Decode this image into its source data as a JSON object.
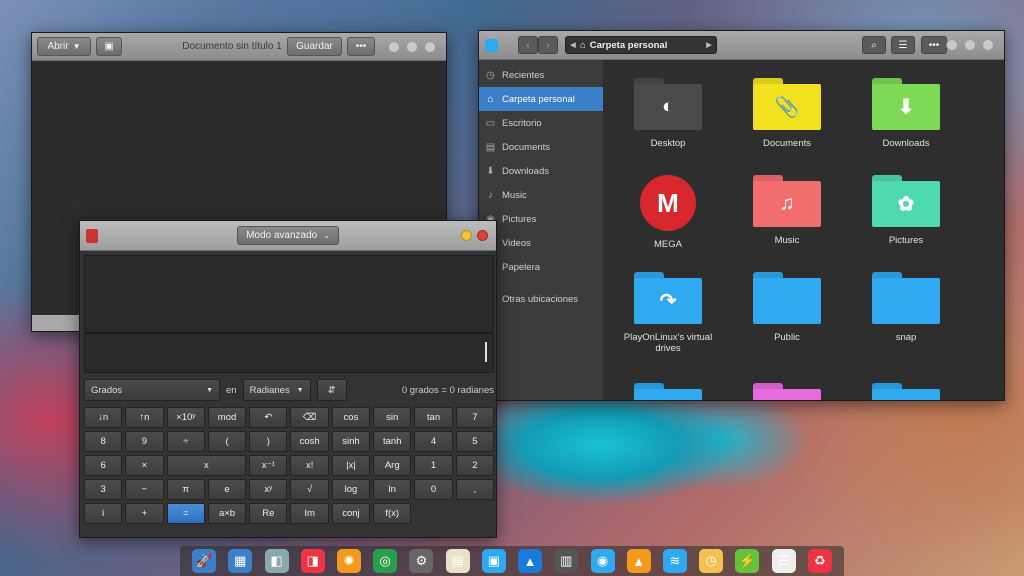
{
  "editor": {
    "open_label": "Abrir",
    "title": "Documento sin título 1",
    "save_label": "Guardar",
    "menu_label": "•••"
  },
  "files": {
    "path_label": "Carpeta personal",
    "menu_label": "•••",
    "sidebar": [
      {
        "label": "Recientes",
        "icon": "clock-icon",
        "glyph": "◷"
      },
      {
        "label": "Carpeta personal",
        "icon": "home-icon",
        "glyph": "⌂"
      },
      {
        "label": "Escritorio",
        "icon": "desktop-icon",
        "glyph": "▭"
      },
      {
        "label": "Documents",
        "icon": "document-icon",
        "glyph": "▤"
      },
      {
        "label": "Downloads",
        "icon": "download-icon",
        "glyph": "⬇"
      },
      {
        "label": "Music",
        "icon": "music-icon",
        "glyph": "♪"
      },
      {
        "label": "Pictures",
        "icon": "camera-icon",
        "glyph": "◉"
      },
      {
        "label": "Videos",
        "icon": "video-icon",
        "glyph": "▶"
      },
      {
        "label": "Papelera",
        "icon": "trash-icon",
        "glyph": "🗑"
      },
      {
        "label": "Otras ubicaciones",
        "icon": "plus-icon",
        "glyph": "+"
      }
    ],
    "items": [
      {
        "label": "Desktop",
        "color": "#4a4a4a",
        "emblem": "◐"
      },
      {
        "label": "Documents",
        "color": "#f2e11f",
        "emblem": "📎"
      },
      {
        "label": "Downloads",
        "color": "#7ed957",
        "emblem": "⬇"
      },
      {
        "label": "MEGA",
        "color": "#d9272e",
        "emblem": "M"
      },
      {
        "label": "Music",
        "color": "#f26d6d",
        "emblem": "♫"
      },
      {
        "label": "Pictures",
        "color": "#4fd9b0",
        "emblem": "✿"
      },
      {
        "label": "PlayOnLinux's virtual drives",
        "color": "#2fa9f0",
        "emblem": "↷"
      },
      {
        "label": "Public",
        "color": "#2fa9f0",
        "emblem": ""
      },
      {
        "label": "snap",
        "color": "#2fa9f0",
        "emblem": ""
      },
      {
        "label": "",
        "color": "#2fa9f0",
        "emblem": ""
      },
      {
        "label": "",
        "color": "#e86be0",
        "emblem": ""
      },
      {
        "label": "",
        "color": "#2fa9f0",
        "emblem": ""
      }
    ]
  },
  "calc": {
    "mode_label": "Modo avanzado",
    "angle_unit": "Grados",
    "in_label": "en",
    "target_unit": "Radianes",
    "swap_glyph": "⇵",
    "result_text": "0 grados = 0 radianes",
    "keys": [
      "↓n",
      "↑n",
      "×10ʸ",
      "mod",
      "↶",
      "⌫",
      "cos",
      "sin",
      "tan",
      "7",
      "8",
      "9",
      "÷",
      "(",
      ")",
      "cosh",
      "sinh",
      "tanh",
      "4",
      "5",
      "6",
      "×",
      "x",
      "x⁻¹",
      "x!",
      "|x|",
      "Arg",
      "1",
      "2",
      "3",
      "−",
      "π",
      "e",
      "xʸ",
      "√",
      "log",
      "ln",
      "0",
      ",",
      "i",
      "+",
      "=",
      "a×b",
      "Re",
      "Im",
      "conj",
      "f(x)"
    ]
  },
  "dock": [
    {
      "name": "launcher-icon",
      "glyph": "🚀",
      "color": "#3b7fc6"
    },
    {
      "name": "multitask-icon",
      "glyph": "▦",
      "color": "#3b7fc6"
    },
    {
      "name": "screenshot-icon",
      "glyph": "◧",
      "color": "#8aa"
    },
    {
      "name": "finder-icon",
      "glyph": "◨",
      "color": "#e34"
    },
    {
      "name": "orange-icon",
      "glyph": "✺",
      "color": "#f39a1e"
    },
    {
      "name": "chrome-icon",
      "glyph": "◎",
      "color": "#2a9d4a"
    },
    {
      "name": "settings-icon",
      "glyph": "⚙",
      "color": "#666"
    },
    {
      "name": "notes-icon",
      "glyph": "▤",
      "color": "#e9e1c8"
    },
    {
      "name": "files-icon",
      "glyph": "▣",
      "color": "#2fa9f0"
    },
    {
      "name": "appstore-icon",
      "glyph": "▲",
      "color": "#1b7ad9"
    },
    {
      "name": "calculator-icon",
      "glyph": "▥",
      "color": "#555"
    },
    {
      "name": "record-icon",
      "glyph": "◉",
      "color": "#2fa9f0"
    },
    {
      "name": "vlc-icon",
      "glyph": "▲",
      "color": "#f39a1e"
    },
    {
      "name": "wifi-icon",
      "glyph": "≋",
      "color": "#2fa9f0"
    },
    {
      "name": "clock-icon",
      "glyph": "◷",
      "color": "#f2c14e"
    },
    {
      "name": "power-icon",
      "glyph": "⚡",
      "color": "#66c23a"
    },
    {
      "name": "mixer-icon",
      "glyph": "☰",
      "color": "#eee"
    },
    {
      "name": "trash-icon",
      "glyph": "♻",
      "color": "#e34"
    }
  ]
}
